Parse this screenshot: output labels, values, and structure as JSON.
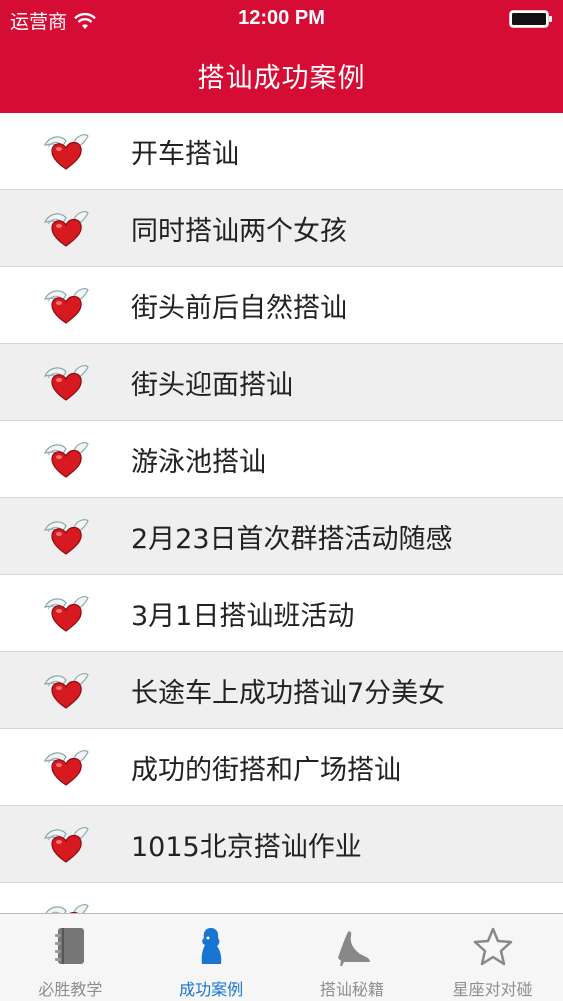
{
  "status_bar": {
    "carrier": "运营商",
    "time": "12:00 PM"
  },
  "nav": {
    "title": "搭讪成功案例"
  },
  "list": {
    "items": [
      {
        "label": "开车搭讪"
      },
      {
        "label": "同时搭讪两个女孩"
      },
      {
        "label": "街头前后自然搭讪"
      },
      {
        "label": "街头迎面搭讪"
      },
      {
        "label": "游泳池搭讪"
      },
      {
        "label": "2月23日首次群搭活动随感"
      },
      {
        "label": "3月1日搭讪班活动"
      },
      {
        "label": "长途车上成功搭讪7分美女"
      },
      {
        "label": "成功的街搭和广场搭讪"
      },
      {
        "label": "1015北京搭讪作业"
      }
    ]
  },
  "tabbar": {
    "tabs": [
      {
        "label": "必胜教学",
        "icon": "notebook-icon"
      },
      {
        "label": "成功案例",
        "icon": "person-icon"
      },
      {
        "label": "搭讪秘籍",
        "icon": "high-heel-icon"
      },
      {
        "label": "星座对对碰",
        "icon": "star-icon"
      }
    ],
    "active_index": 1
  },
  "colors": {
    "header_bg": "#d50d35",
    "active_tab": "#1875d2",
    "inactive_tab": "#8e8e93"
  }
}
